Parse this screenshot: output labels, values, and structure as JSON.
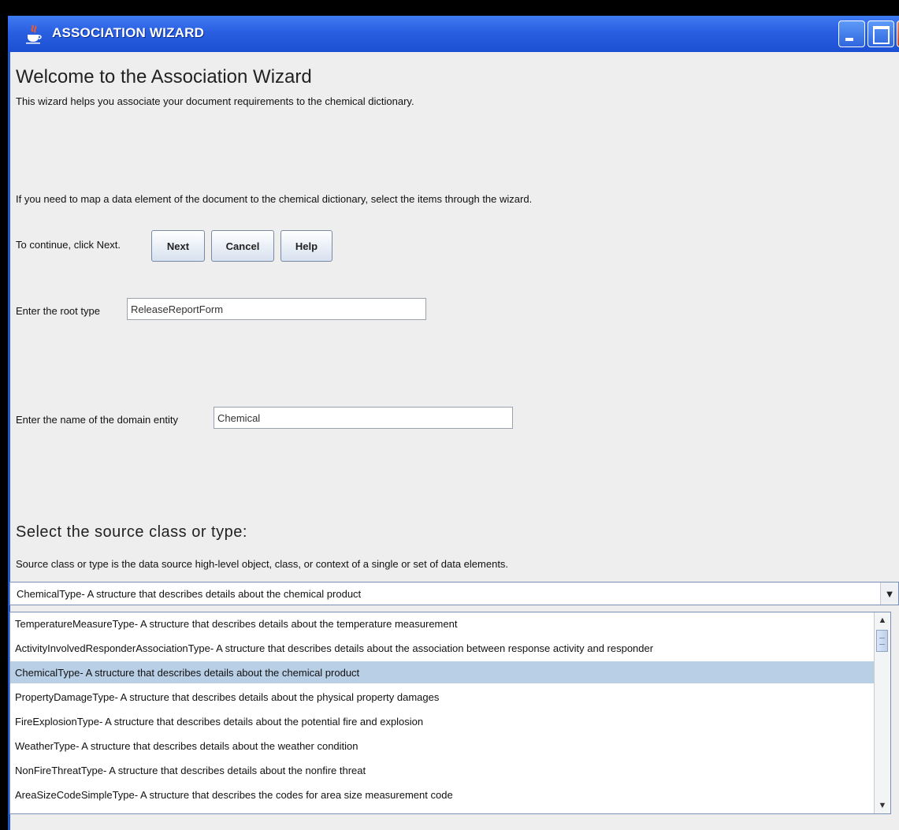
{
  "window": {
    "title": "ASSOCIATION WIZARD",
    "app_icon": "java-cup-icon"
  },
  "intro": {
    "heading": "Welcome to the Association Wizard",
    "description": "This wizard helps you associate your document requirements to the chemical dictionary.",
    "instruction": "If you need to map a data element of the document to the chemical dictionary, select the items through the wizard.",
    "continue_text": "To continue, click Next."
  },
  "buttons": {
    "next": "Next",
    "cancel": "Cancel",
    "help": "Help"
  },
  "root_type": {
    "label": "Enter the root type",
    "value": "ReleaseReportForm"
  },
  "domain_entity": {
    "label": "Enter the name of the domain entity",
    "value": "Chemical"
  },
  "source": {
    "heading": "Select the source class or type:",
    "description": "Source class or type is the data source high-level object, class, or context of a single or set of data elements.",
    "selected": "ChemicalType- A structure that describes details about the chemical product",
    "items": [
      "TemperatureMeasureType- A structure that describes details about the temperature measurement",
      "ActivityInvolvedResponderAssociationType- A structure that describes details about the association between response activity and responder",
      "ChemicalType- A structure that describes details about the chemical product",
      "PropertyDamageType- A structure that describes details about the physical property damages",
      "FireExplosionType- A structure that describes details about the potential fire and explosion",
      "WeatherType- A structure that describes details about the weather condition",
      "NonFireThreatType- A structure that describes details about the nonfire threat",
      "AreaSizeCodeSimpleType- A structure that describes the codes for area size measurement code"
    ]
  }
}
